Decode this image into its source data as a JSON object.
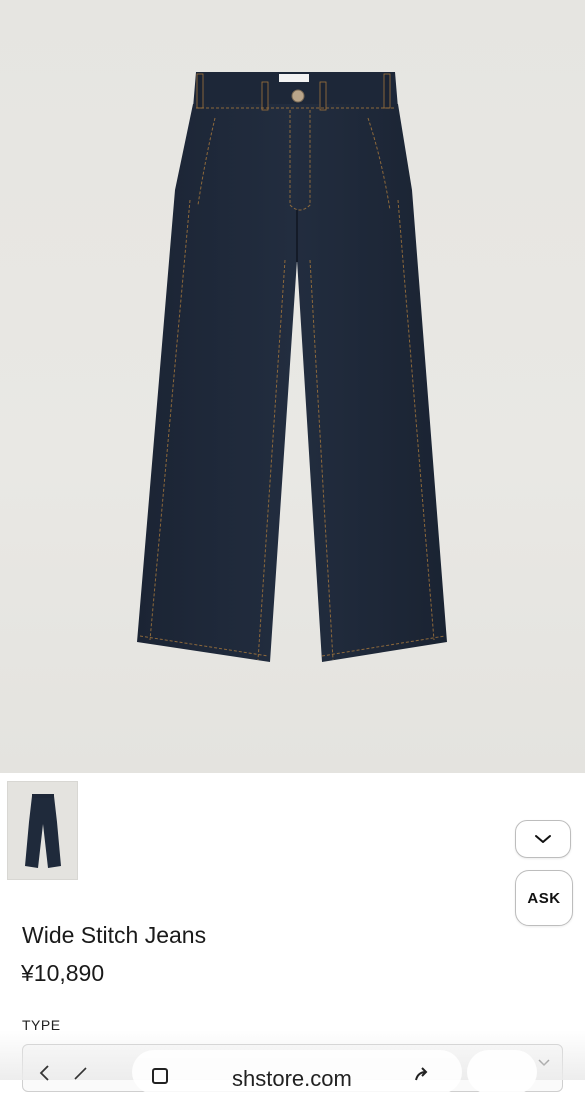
{
  "product": {
    "title": "Wide Stitch Jeans",
    "price": "¥10,890",
    "type_label": "TYPE",
    "image_alt": "Wide Stitch Jeans",
    "main_color": "#1f2a3b",
    "stitch_color": "#a0743c"
  },
  "actions": {
    "ask_label": "ASK",
    "collapse_icon": "chevron-down-icon"
  },
  "browser": {
    "url": "shstore.com"
  }
}
